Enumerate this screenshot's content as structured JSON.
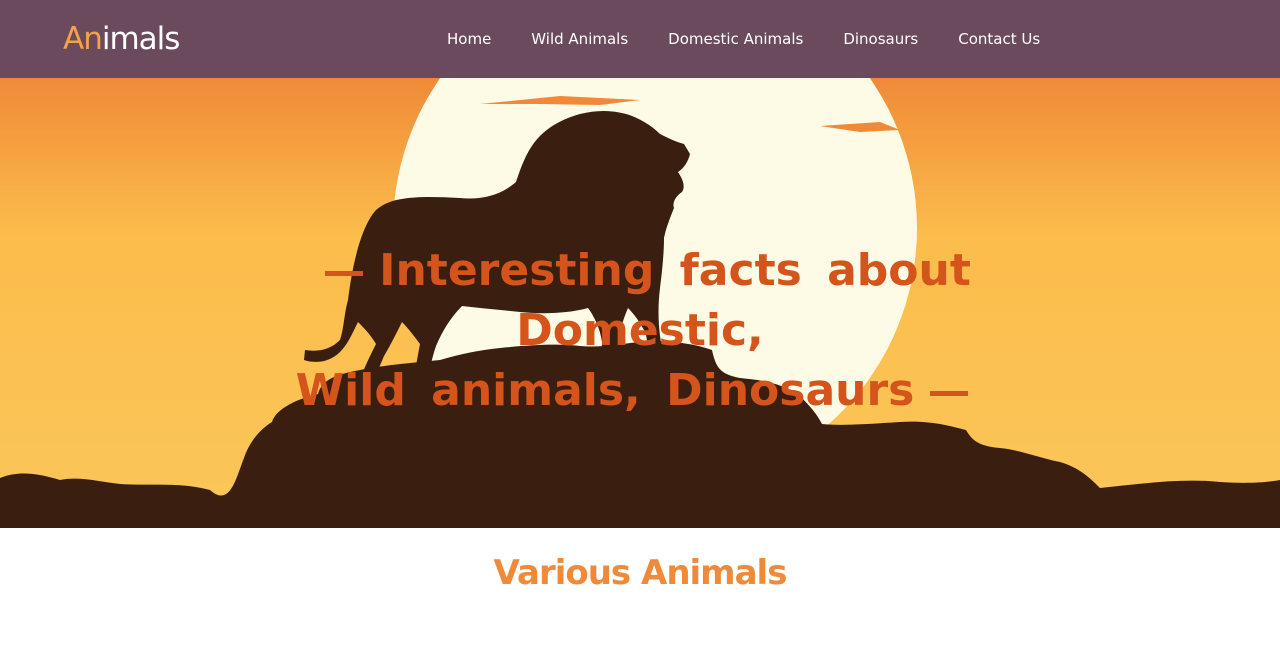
{
  "header": {
    "logo": {
      "part1": "An",
      "part2": "imals"
    },
    "nav": [
      {
        "label": "Home"
      },
      {
        "label": "Wild Animals"
      },
      {
        "label": "Domestic Animals"
      },
      {
        "label": "Dinosaurs"
      },
      {
        "label": "Contact Us"
      }
    ]
  },
  "hero": {
    "image": "lion-silhouette-sunset",
    "headline_line1": "Interesting facts about Domestic,",
    "headline_line2": "Wild animals, Dinosaurs"
  },
  "main": {
    "section_title": "Various Animals"
  },
  "colors": {
    "navbar": "#6b4a5e",
    "logo_accent": "#f3a246",
    "headline": "#d4541c",
    "section_title": "#ef8a3b",
    "sky_top": "#f08a38",
    "sky_bottom": "#fbc24f",
    "sun": "#fdfbe6",
    "silhouette": "#3a1f10"
  }
}
